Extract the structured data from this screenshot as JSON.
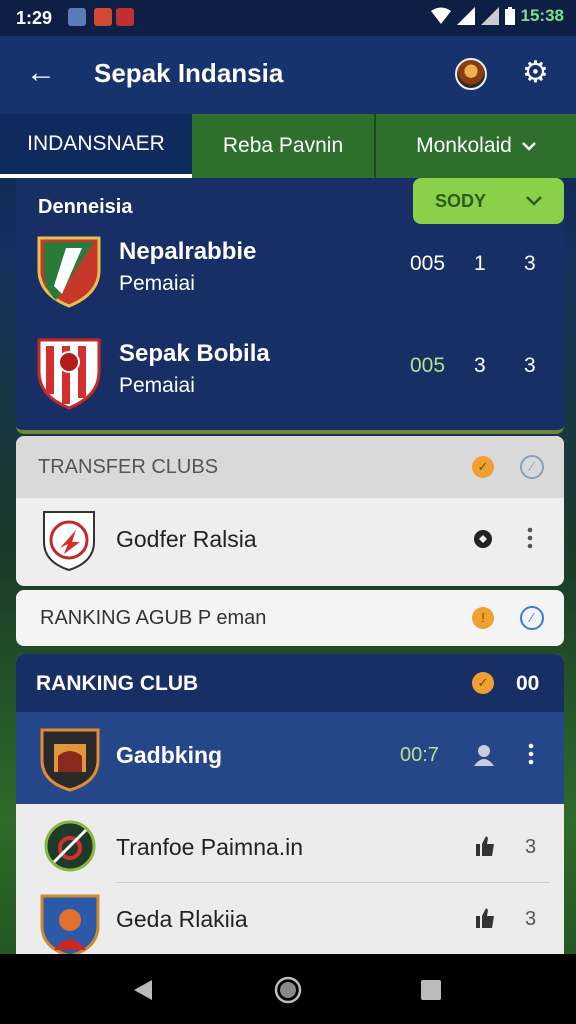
{
  "status_bar": {
    "time": "1:29",
    "clock": "15:38"
  },
  "app_bar": {
    "title": "Sepak Indansia",
    "back_icon": "←",
    "settings_icon": "⚙"
  },
  "tabs": [
    {
      "label": "INDANSNAER"
    },
    {
      "label": "Reba Pavnin"
    },
    {
      "label": "Monkolaid"
    }
  ],
  "match_card": {
    "league": "Denneisia",
    "badge": "SODY",
    "rows": [
      {
        "name": "Nepalrabbie",
        "sub": "Pemaiai",
        "s1": "005",
        "s2": "1",
        "s3": "3"
      },
      {
        "name": "Sepak Bobila",
        "sub": "Pemaiai",
        "s1": "005",
        "s2": "3",
        "s3": "3"
      }
    ]
  },
  "transfer_card": {
    "header": "TRANSFER CLUBS",
    "row_name": "Godfer Ralsia"
  },
  "ranking_search": {
    "label": "RANKING AGUB P eman"
  },
  "ranking_club": {
    "header": "RANKING CLUB",
    "header_value": "00",
    "rows": [
      {
        "name": "Gadbking",
        "value": "00:7"
      },
      {
        "name": "Tranfoe Paimna.in",
        "value": "3"
      },
      {
        "name": "Geda Rlakiia",
        "value": "3"
      }
    ]
  },
  "colors": {
    "primary": "#17336e",
    "accent_green": "#8ad14a",
    "tab_green": "#2e6f2e",
    "orange": "#f0a030"
  }
}
